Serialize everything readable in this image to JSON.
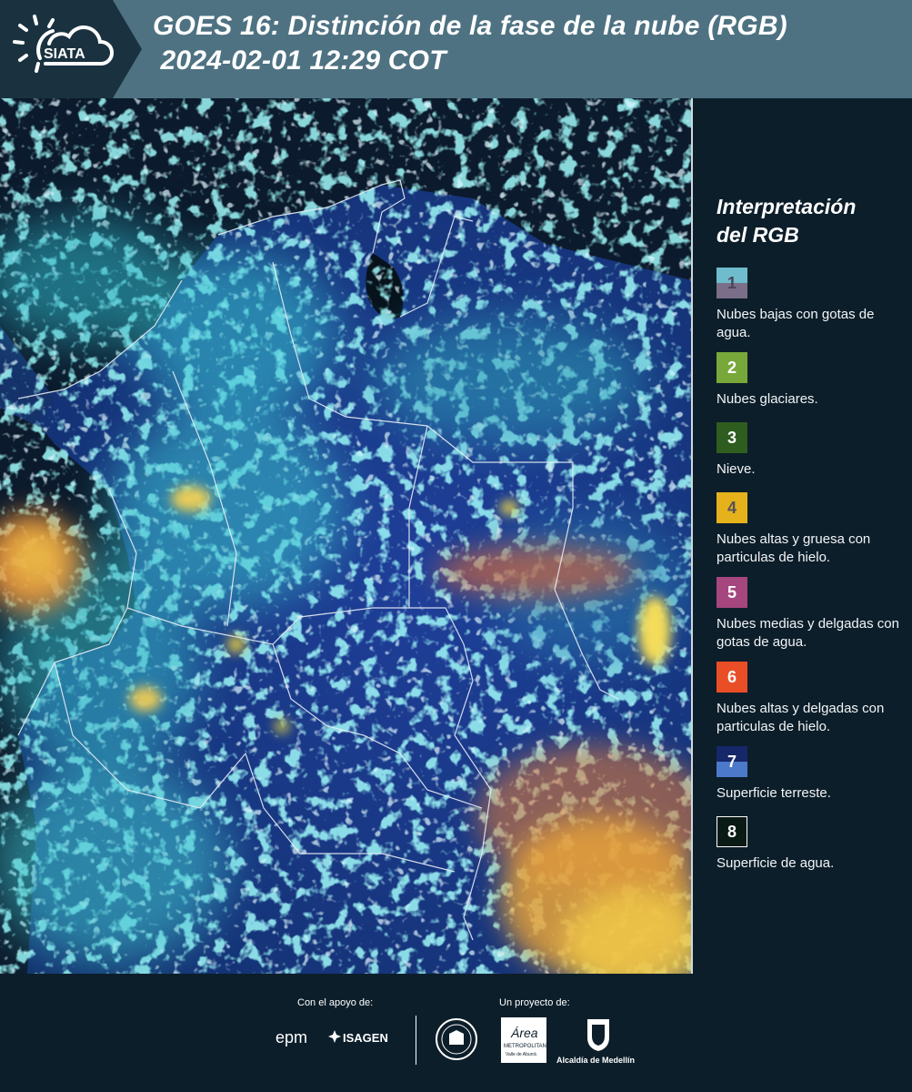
{
  "header": {
    "logo_text": "SIATA",
    "title": "GOES 16: Distinción de la fase de la nube (RGB)\n 2024-02-01 12:29 COT"
  },
  "legend": {
    "title": "Interpretación\ndel RGB",
    "items": [
      {
        "number": "1",
        "label": "Nubes bajas con gotas de agua.",
        "color_top": "#6fbccc",
        "color_bottom": "#7a6e88",
        "text_color": "#4a4458"
      },
      {
        "number": "2",
        "label": "Nubes glaciares.",
        "color_top": "#78a83a",
        "text_color": "#ffffff"
      },
      {
        "number": "3",
        "label": "Nieve.",
        "color_top": "#2f5c1f",
        "text_color": "#ffffff"
      },
      {
        "number": "4",
        "label": "Nubes altas y gruesa con particulas de hielo.",
        "color_top": "#e5b21c",
        "text_color": "#55505a"
      },
      {
        "number": "5",
        "label": "Nubes medias y delgadas con gotas de agua.",
        "color_top": "#a6467e",
        "text_color": "#ffffff"
      },
      {
        "number": "6",
        "label": "Nubes altas y delgadas con particulas de hielo.",
        "color_top": "#ea4e26",
        "text_color": "#ffffff"
      },
      {
        "number": "7",
        "label": "Superficie terreste.",
        "color_top": "#16286a",
        "color_bottom": "#4c79c9",
        "text_color": "#ffffff"
      },
      {
        "number": "8",
        "label": "Superficie de agua.",
        "color_top": "#0a1a14",
        "border": "#ffffff",
        "text_color": "#ffffff"
      }
    ]
  },
  "footer": {
    "support_label": "Con el apoyo de:",
    "project_label": "Un proyecto de:",
    "epm_text": "epm",
    "isagen_text": "ISAGEN",
    "area_text": "Área",
    "area_subtext": "METROPOLITANA",
    "area_subtext2": "Valle de Aburrá",
    "alcaldia_text": "Alcaldía de Medellín"
  }
}
